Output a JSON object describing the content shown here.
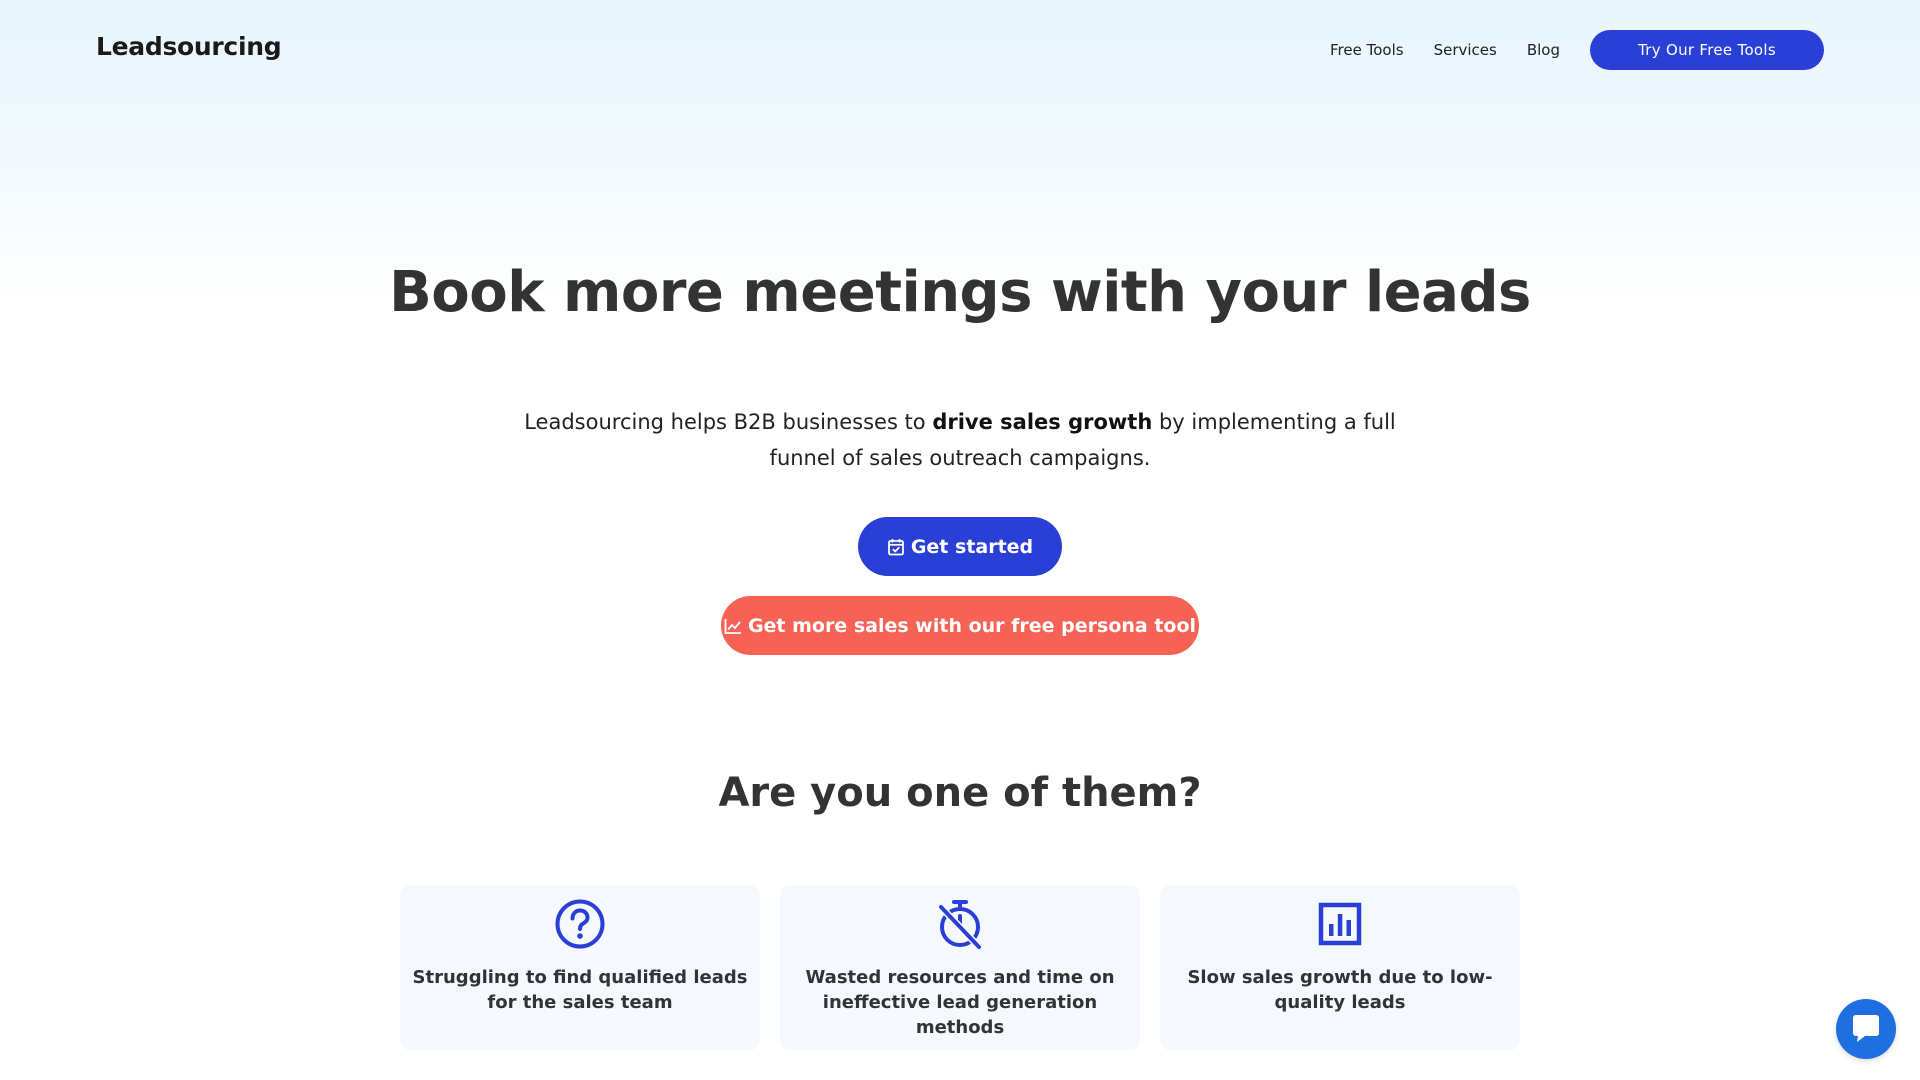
{
  "header": {
    "logo": "Leadsourcing",
    "nav": [
      {
        "label": "Free Tools"
      },
      {
        "label": "Services"
      },
      {
        "label": "Blog"
      }
    ],
    "cta_label": "Try Our Free Tools"
  },
  "hero": {
    "title": "Book more meetings with your leads",
    "subtitle_before": "Leadsourcing helps B2B businesses to ",
    "subtitle_bold": "drive sales growth",
    "subtitle_after": " by implementing a full funnel of sales outreach campaigns.",
    "primary_button": {
      "label": "Get started",
      "icon": "calendar-check-icon"
    },
    "secondary_button": {
      "label": "Get more sales with our free persona tool",
      "icon": "line-chart-icon"
    }
  },
  "pain_points": {
    "title": "Are you one of them?",
    "cards": [
      {
        "icon": "question-circle-icon",
        "text": "Struggling to find qualified leads for the sales team"
      },
      {
        "icon": "stopwatch-off-icon",
        "text": "Wasted resources and time on ineffective lead generation methods"
      },
      {
        "icon": "bar-chart-square-icon",
        "text": "Slow sales growth due to low-quality leads"
      }
    ]
  },
  "chat": {
    "icon": "chat-bubble-icon"
  },
  "colors": {
    "accent": "#2a3fd6",
    "secondary": "#f76256",
    "chat": "#1f6fe0",
    "heading": "#333333"
  }
}
